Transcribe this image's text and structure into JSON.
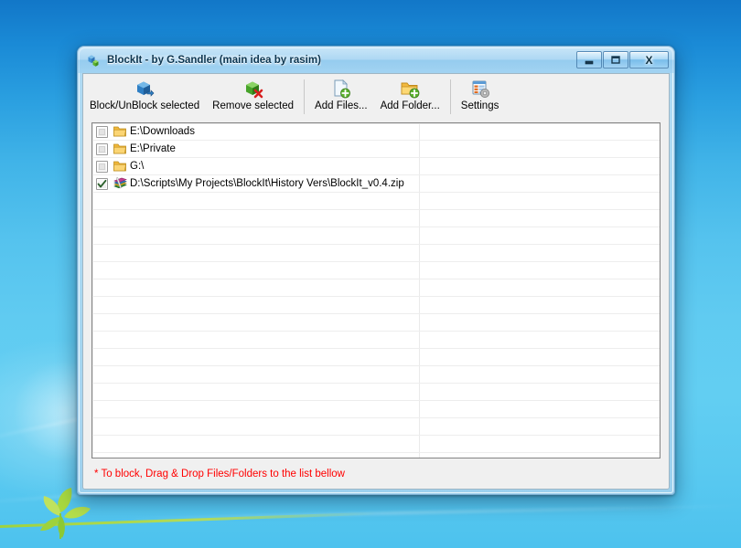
{
  "window": {
    "title": "BlockIt - by G.Sandler (main idea by rasim)",
    "app_icon": "blocks-icon",
    "caption": {
      "minimize_label": "—",
      "minimize_icon": "minimize-icon",
      "maximize_label": "□",
      "maximize_icon": "maximize-icon",
      "close_label": "X",
      "close_icon": "close-icon"
    }
  },
  "toolbar": {
    "buttons": [
      {
        "label": "Block/UnBlock selected",
        "icon": "blue-box-icon"
      },
      {
        "label": "Remove selected",
        "icon": "green-box-delete-icon"
      },
      {
        "label": "Add Files...",
        "icon": "document-add-icon"
      },
      {
        "label": "Add Folder...",
        "icon": "folder-add-icon"
      },
      {
        "label": "Settings",
        "icon": "settings-list-gear-icon"
      }
    ]
  },
  "list": {
    "rows": [
      {
        "checked": false,
        "icon": "folder-icon",
        "path": "E:\\Downloads"
      },
      {
        "checked": false,
        "icon": "folder-icon",
        "path": "E:\\Private"
      },
      {
        "checked": false,
        "icon": "folder-icon",
        "path": "G:\\"
      },
      {
        "checked": true,
        "icon": "archive-zip-icon",
        "path": "D:\\Scripts\\My Projects\\BlockIt\\History Vers\\BlockIt_v0.4.zip"
      }
    ],
    "empty_row_count": 17
  },
  "hint": {
    "text": "* To block, Drag & Drop Files/Folders to the list bellow",
    "color": "#ff0000"
  },
  "colors": {
    "desktop_top": "#1277c8",
    "desktop_bottom": "#4dc2ee",
    "window_bg": "#f0f0f0",
    "list_bg": "#ffffff",
    "hint_red": "#ff0000",
    "leaf_green": "#9ed23c"
  }
}
